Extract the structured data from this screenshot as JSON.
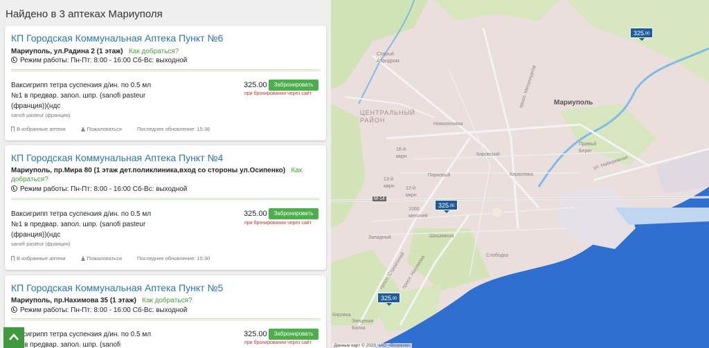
{
  "header": {
    "title": "Найдено в 3 аптеках Мариуполя"
  },
  "pharmacies": [
    {
      "name": "КП Городская Коммунальная Аптека Пункт №6",
      "address": "Мариуполь, ул.Радина 2 (1 этаж)",
      "how_to_get": "Как добраться?",
      "hours": "Режим работы: Пн-Пт: 8:00 - 16:00 Сб-Вс: выходной",
      "product": "Ваксигрипп тетра суспензия д/ин. по 0.5 мл №1 в предвар. запол. шпр. (sanofi pasteur (франция))(ндс",
      "manufacturer": "sanofi pasteur (франция)",
      "price": "325.00",
      "reserve": "Забронировать",
      "reserve_note": "при бронировании через сайт",
      "favorite": "В избранные аптеки",
      "complain": "Пожаловаться",
      "updated": "Последнее обновление: 15:36"
    },
    {
      "name": "КП Городская Коммунальная Аптека Пункт №4",
      "address": "Мариуполь, пр.Мира 80 (1 этаж дет.поликлиника,вход со стороны ул.Осипенко)",
      "how_to_get": "Как добраться?",
      "hours": "Режим работы: Пн-Пт: 8:00 - 16:00 Сб-Вс: выходной",
      "product": "Ваксигрипп тетра суспензия д/ин. по 0.5 мл №1 в предвар. запол. шпр. (sanofi pasteur (франция))(ндс",
      "manufacturer": "sanofi pasteur (франция)",
      "price": "325.00",
      "reserve": "Забронировать",
      "reserve_note": "при бронировании через сайт",
      "favorite": "В избранные аптеки",
      "complain": "Пожаловаться",
      "updated": "Последнее обновление: 15:30"
    },
    {
      "name": "КП Городская Коммунальная Аптека Пункт №5",
      "address": "Мариуполь, пр.Нахимова 35 (1 этаж)",
      "how_to_get": "Как добраться?",
      "hours": "Режим работы: Пн-Пт: 8:00 - 16:00 Сб-Вс: выходной",
      "product": "Ваксигрипп тетра суспензия д/ин. по 0.5 мл №1 в предвар. запол. шпр. (sanofi",
      "price": "325.00",
      "reserve": "Забронировать",
      "reserve_note": "при бронировании через сайт"
    }
  ],
  "map": {
    "pins": [
      {
        "main": "325",
        "kop": ",00"
      },
      {
        "main": "325",
        "kop": ",00"
      },
      {
        "main": "325",
        "kop": ",00"
      }
    ],
    "labels": {
      "city": "Мариуполь",
      "central": "ЦЕНТРАЛЬНЫЙ РАЙОН",
      "old_airport": "Старый Аэродром",
      "novoselovka": "Новоселовка",
      "kirovsky": "Кировский",
      "karasevka": "Карасевка",
      "mkr16": "16-й мкрн",
      "mkr13": "13-й мкрн",
      "mkr12": "12-й мкрн",
      "parkovy": "Парковый",
      "melochey": "1000 мелочей",
      "zapadny": "Западный",
      "shishmanka": "Шишманка",
      "slobodka": "Слободка",
      "kirovka": "Кировка",
      "zintsevaya": "Зинцевая Балка",
      "pravy_bereg": "Правый Берег",
      "naberezhnaya": "ул. Набережная",
      "metallurgov": "просп. Металлургов",
      "stroiteley": "просп. Строителей",
      "nakhimova": "просп. Нахимова",
      "road": "М-14",
      "copyright": "Данные карт © 2020 ЧАО «Визиком»"
    }
  },
  "colors": {
    "accent": "#2a74b6",
    "green": "#4caf4c",
    "note": "#c0392b",
    "pin": "#1d5b9a",
    "sea": "#2f6fd0"
  },
  "icons": {
    "scroll_top": "chevron-up-icon",
    "clock": "clock-icon",
    "bookmark": "bookmark-icon",
    "warning": "warning-icon"
  }
}
